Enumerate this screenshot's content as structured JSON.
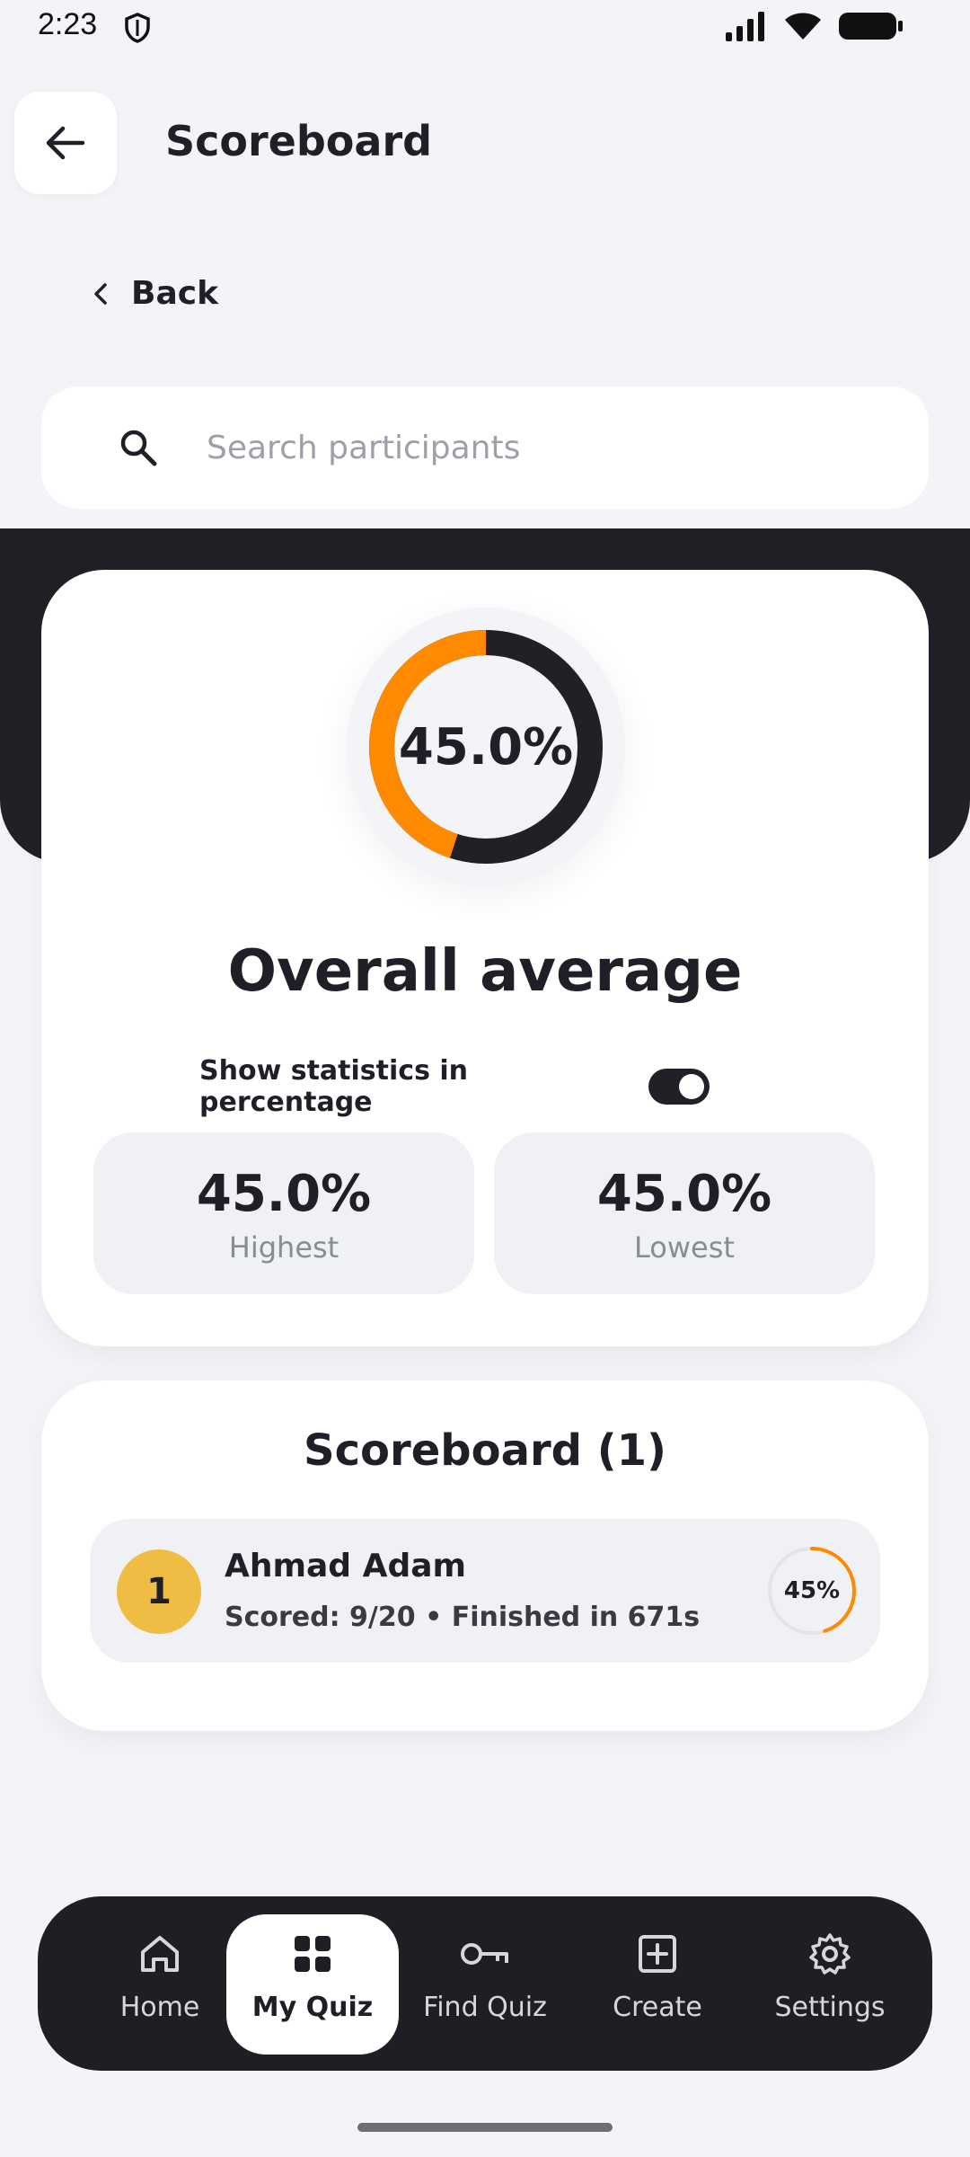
{
  "status_bar": {
    "time": "2:23"
  },
  "header": {
    "title": "Scoreboard",
    "back_label": "Back"
  },
  "search": {
    "placeholder": "Search participants",
    "value": ""
  },
  "overall": {
    "average_text": "45.0%",
    "average_value": 45.0,
    "title": "Overall average",
    "toggle_label": "Show statistics in percentage",
    "toggle_on": true,
    "highest": {
      "value": "45.0%",
      "label": "Highest"
    },
    "lowest": {
      "value": "45.0%",
      "label": "Lowest"
    }
  },
  "scoreboard": {
    "title": "Scoreboard (1)",
    "entries": [
      {
        "rank": "1",
        "name": "Ahmad Adam",
        "detail": "Scored: 9/20 • Finished in 671s",
        "percent_text": "45%",
        "percent_value": 45
      }
    ]
  },
  "nav": {
    "items": [
      {
        "label": "Home",
        "icon": "home-icon"
      },
      {
        "label": "My Quiz",
        "icon": "grid-icon",
        "active": true
      },
      {
        "label": "Find Quiz",
        "icon": "key-icon"
      },
      {
        "label": "Create",
        "icon": "plus-square-icon"
      },
      {
        "label": "Settings",
        "icon": "gear-icon"
      }
    ]
  },
  "colors": {
    "accent": "#ff8a00",
    "dark": "#202126",
    "rank_badge": "#efbd44",
    "background": "#f3f4f8"
  }
}
